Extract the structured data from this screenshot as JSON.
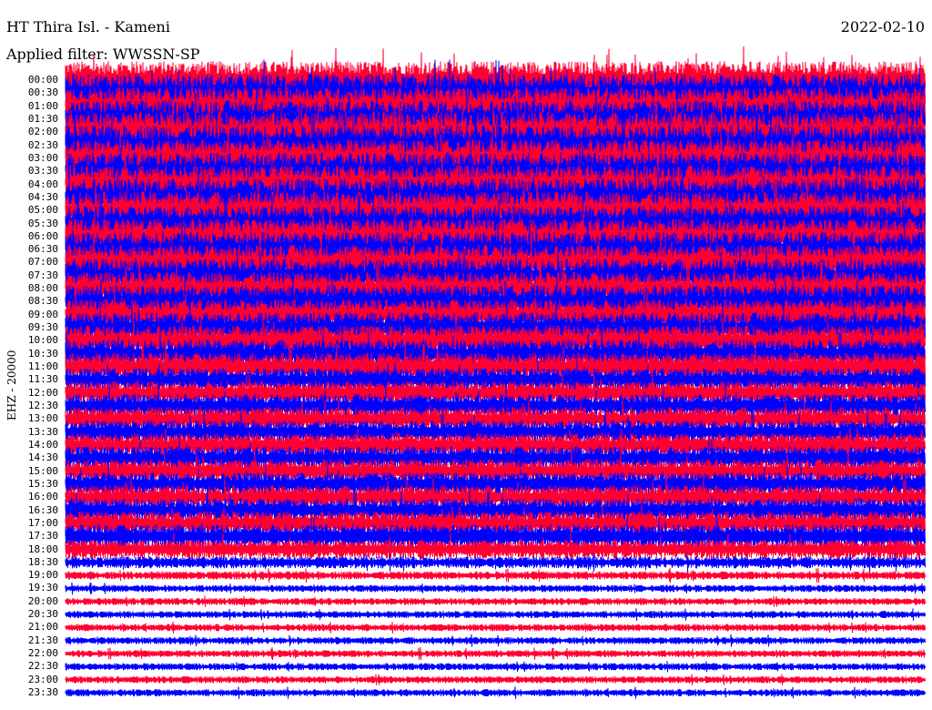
{
  "header": {
    "station": "HT Thira Isl. - Kameni",
    "filter": "Applied filter: WWSSN-SP",
    "date": "2022-02-10",
    "channel": "EHZ - 20000"
  },
  "colors": {
    "trace_a": "#ff0033",
    "trace_b": "#0000ff",
    "background": "#ffffff"
  },
  "chart_data": {
    "type": "line",
    "title": "HT Thira Isl. - Kameni",
    "ylabel": "EHZ - 20000",
    "row_labels": [
      "00:00",
      "00:30",
      "01:00",
      "01:30",
      "02:00",
      "02:30",
      "03:00",
      "03:30",
      "04:00",
      "04:30",
      "05:00",
      "05:30",
      "06:00",
      "06:30",
      "07:00",
      "07:30",
      "08:00",
      "08:30",
      "09:00",
      "09:30",
      "10:00",
      "10:30",
      "11:00",
      "11:30",
      "12:00",
      "12:30",
      "13:00",
      "13:30",
      "14:00",
      "14:30",
      "15:00",
      "15:30",
      "16:00",
      "16:30",
      "17:00",
      "17:30",
      "18:00",
      "18:30",
      "19:00",
      "19:30",
      "20:00",
      "20:30",
      "21:00",
      "21:30",
      "22:00",
      "22:30",
      "23:00",
      "23:30"
    ],
    "relative_amplitude": [
      1.6,
      1.6,
      1.6,
      1.6,
      1.7,
      1.7,
      1.6,
      1.6,
      1.6,
      1.6,
      1.6,
      1.5,
      1.5,
      1.5,
      1.5,
      1.4,
      1.4,
      1.4,
      1.3,
      1.3,
      1.3,
      1.2,
      1.2,
      1.0,
      1.0,
      1.0,
      1.0,
      1.0,
      1.0,
      1.0,
      1.0,
      1.0,
      1.0,
      1.0,
      1.0,
      1.0,
      0.8,
      0.5,
      0.35,
      0.3,
      0.3,
      0.3,
      0.3,
      0.3,
      0.3,
      0.3,
      0.3,
      0.3
    ]
  }
}
